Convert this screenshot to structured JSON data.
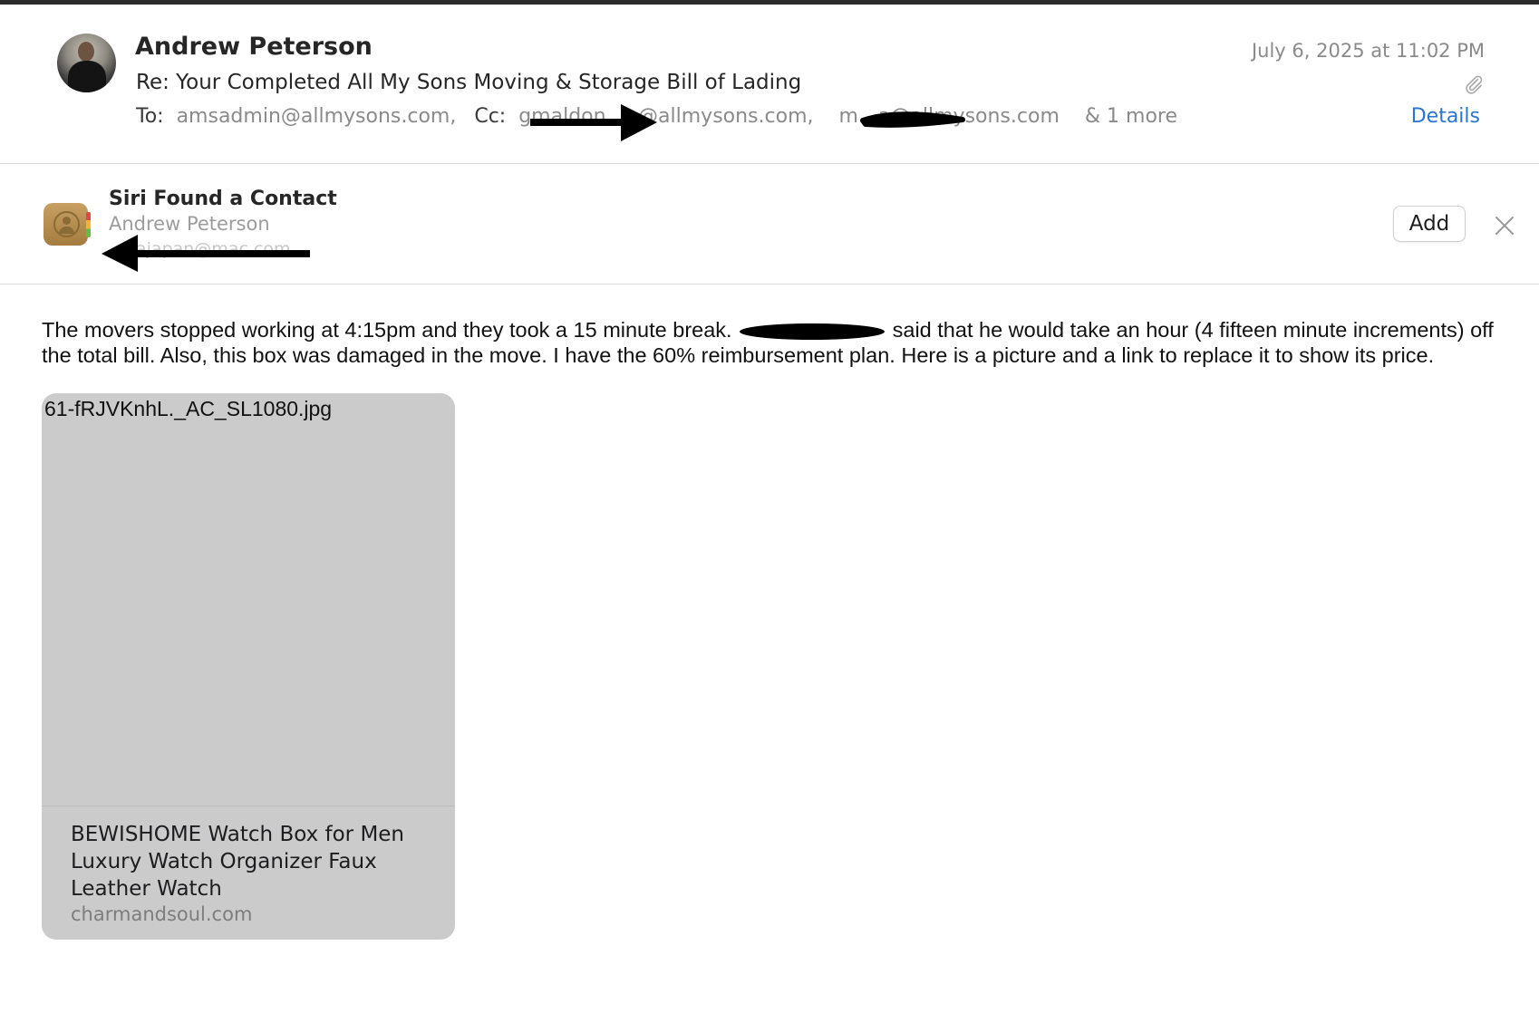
{
  "email": {
    "sender": "Andrew Peterson",
    "date": "July 6, 2025 at 11:02 PM",
    "subject": "Re: Your Completed All My Sons Moving & Storage Bill of Lading",
    "to_label": "To:",
    "to": "amsadmin@allmysons.com,",
    "cc_label": "Cc:",
    "cc": [
      "gmaldon…o@allmysons.com,",
      "m…a@allmysons.com"
    ],
    "more": "& 1 more",
    "details_label": "Details",
    "attachment_icon": "paperclip-icon"
  },
  "siri": {
    "title": "Siri Found a Contact",
    "name": "Andrew Peterson",
    "email": "ajapan@mac.com",
    "add_label": "Add",
    "close_icon": "close-icon"
  },
  "body": {
    "text_before": "The movers stopped working at 4:15pm and they took a 15 minute break.",
    "text_after": "said that he would take an hour (4 fifteen minute increments) off the total bill. Also, this box was damaged in the move. I have the 60% reimbursement plan. Here is a picture and a link to replace it to show its price."
  },
  "attachment": {
    "filename": "61-fRJVKnhL._AC_SL1080.jpg",
    "title": "BEWISHOME Watch Box for Men Luxury Watch Organizer Faux Leather Watch",
    "domain": "charmandsoul.com"
  }
}
